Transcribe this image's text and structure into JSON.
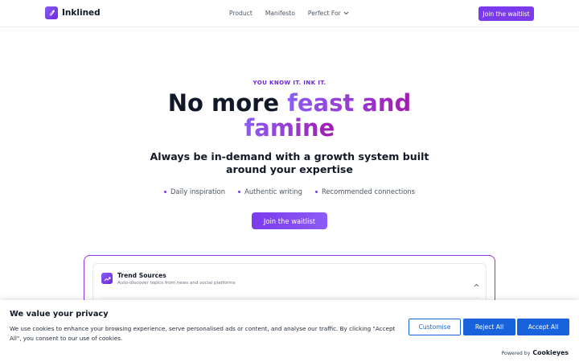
{
  "header": {
    "brand": "Inklined",
    "nav": [
      {
        "label": "Product"
      },
      {
        "label": "Manifesto"
      },
      {
        "label": "Perfect For"
      }
    ],
    "cta": "Join the waitlist"
  },
  "hero": {
    "eyebrow": "YOU KNOW IT. INK IT.",
    "headline_plain": "No more",
    "headline_accent_1": "feast and",
    "headline_accent_2": "famine",
    "subheadline": "Always be in-demand with a growth system built around your expertise",
    "features": [
      "Daily inspiration",
      "Authentic writing",
      "Recommended connections"
    ],
    "cta": "Join the waitlist"
  },
  "preview": {
    "title": "Trend Sources",
    "description": "Auto-discover topics from news and social platforms"
  },
  "cookie_banner": {
    "title": "We value your privacy",
    "text": "We use cookies to enhance your browsing experience, serve personalised ads or content, and analyse our traffic. By clicking \"Accept All\", you consent to our use of cookies.",
    "customise": "Customise",
    "reject": "Reject All",
    "accept": "Accept All",
    "powered_by": "Powered by",
    "powered_brand": "Cookieyes"
  },
  "colors": {
    "brand": "#7c3aed",
    "accent_gradient_end": "#a21caf",
    "cookie_primary": "#1863dc"
  },
  "icons": [
    "logo-feather-icon",
    "chevron-down-icon",
    "trend-icon",
    "chevron-up-icon"
  ]
}
